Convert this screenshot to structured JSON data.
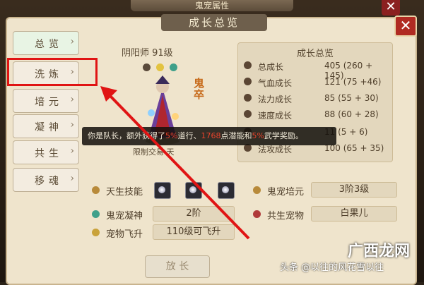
{
  "window": {
    "bg_title": "鬼宠属性",
    "close_symbol": "✕"
  },
  "panel": {
    "title": "成长总览",
    "close_symbol": "✕"
  },
  "tabs": [
    {
      "label": "总览",
      "active": true
    },
    {
      "label": "洗炼",
      "active": false
    },
    {
      "label": "培元",
      "active": false
    },
    {
      "label": "凝神",
      "active": false
    },
    {
      "label": "共生",
      "active": false
    },
    {
      "label": "移魂",
      "active": false
    }
  ],
  "tab_chevron": "›",
  "character": {
    "name_level": "阴阳师 91级",
    "type_label": "鬼卒",
    "sub_text": "限制交易 天"
  },
  "stats": {
    "title": "成长总览",
    "rows": [
      {
        "label": "总成长",
        "value": "405 (260 + 145)"
      },
      {
        "label": "气血成长",
        "value": "121 (75 +46)"
      },
      {
        "label": "法力成长",
        "value": "85 (55 + 30)"
      },
      {
        "label": "速度成长",
        "value": "88 (60 + 28)"
      },
      {
        "label": "",
        "value": "11 (5 + 6)"
      },
      {
        "label": "法攻成长",
        "value": "100 (65 + 35)"
      }
    ]
  },
  "tooltip": {
    "p1": "你是队长，额外获得了",
    "h1": "5%",
    "p2": "道行、",
    "h2": "1768",
    "p3": "点潜能和",
    "h3": "5%",
    "p4": "武学奖励。"
  },
  "lower": {
    "innate_skill_label": "天生技能",
    "cultivate_label": "鬼宠培元",
    "cultivate_value": "3阶3级",
    "focus_label": "鬼宠凝神",
    "focus_value": "2阶",
    "symbiosis_label": "共生宠物",
    "symbiosis_value": "白果儿",
    "ascend_label": "宠物飞升",
    "ascend_value": "110级可飞升"
  },
  "bottom_button": "放 长",
  "watermark": {
    "source": "头条 @以往的风花雪以往",
    "brand": "广西龙网"
  },
  "colors": {
    "annotation_red": "#e01414",
    "highlight_red": "#e8432c"
  }
}
